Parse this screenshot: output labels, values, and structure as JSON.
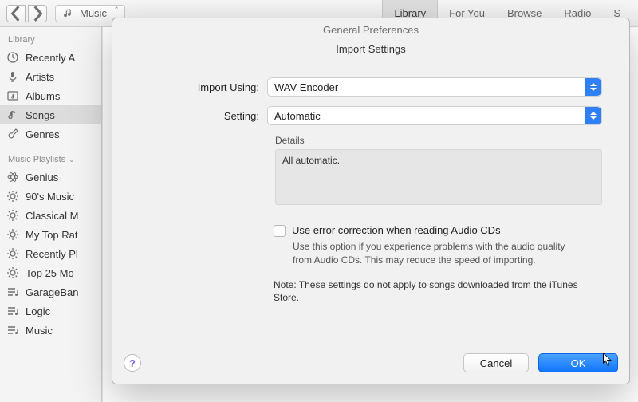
{
  "toolbar": {
    "breadcrumb": "Music",
    "tabs": [
      {
        "label": "Library",
        "active": true
      },
      {
        "label": "For You",
        "active": false
      },
      {
        "label": "Browse",
        "active": false
      },
      {
        "label": "Radio",
        "active": false
      },
      {
        "label": "S",
        "active": false
      }
    ]
  },
  "sidebar": {
    "section1_label": "Library",
    "library_items": [
      {
        "label": "Recently A",
        "icon": "clock-icon"
      },
      {
        "label": "Artists",
        "icon": "microphone-icon"
      },
      {
        "label": "Albums",
        "icon": "album-icon"
      },
      {
        "label": "Songs",
        "icon": "note-icon",
        "selected": true
      },
      {
        "label": "Genres",
        "icon": "guitar-icon"
      }
    ],
    "section2_label": "Music Playlists",
    "playlist_items": [
      {
        "label": "Genius",
        "icon": "atom-icon"
      },
      {
        "label": "90's Music",
        "icon": "gear-icon"
      },
      {
        "label": "Classical M",
        "icon": "gear-icon"
      },
      {
        "label": "My Top Rat",
        "icon": "gear-icon"
      },
      {
        "label": "Recently Pl",
        "icon": "gear-icon"
      },
      {
        "label": "Top 25 Mo",
        "icon": "gear-icon"
      },
      {
        "label": "GarageBan",
        "icon": "playlist-icon"
      },
      {
        "label": "Logic",
        "icon": "playlist-icon"
      },
      {
        "label": "Music",
        "icon": "playlist-icon"
      }
    ]
  },
  "sheet": {
    "title": "General Preferences",
    "subtitle": "Import Settings",
    "import_using_label": "Import Using:",
    "import_using_value": "WAV Encoder",
    "setting_label": "Setting:",
    "setting_value": "Automatic",
    "details_label": "Details",
    "details_text": "All automatic.",
    "checkbox_label": "Use error correction when reading Audio CDs",
    "checkbox_sub": "Use this option if you experience problems with the audio quality from Audio CDs.  This may reduce the speed of importing.",
    "note": "Note: These settings do not apply to songs downloaded from the iTunes Store.",
    "help_glyph": "?",
    "cancel_label": "Cancel",
    "ok_label": "OK"
  }
}
